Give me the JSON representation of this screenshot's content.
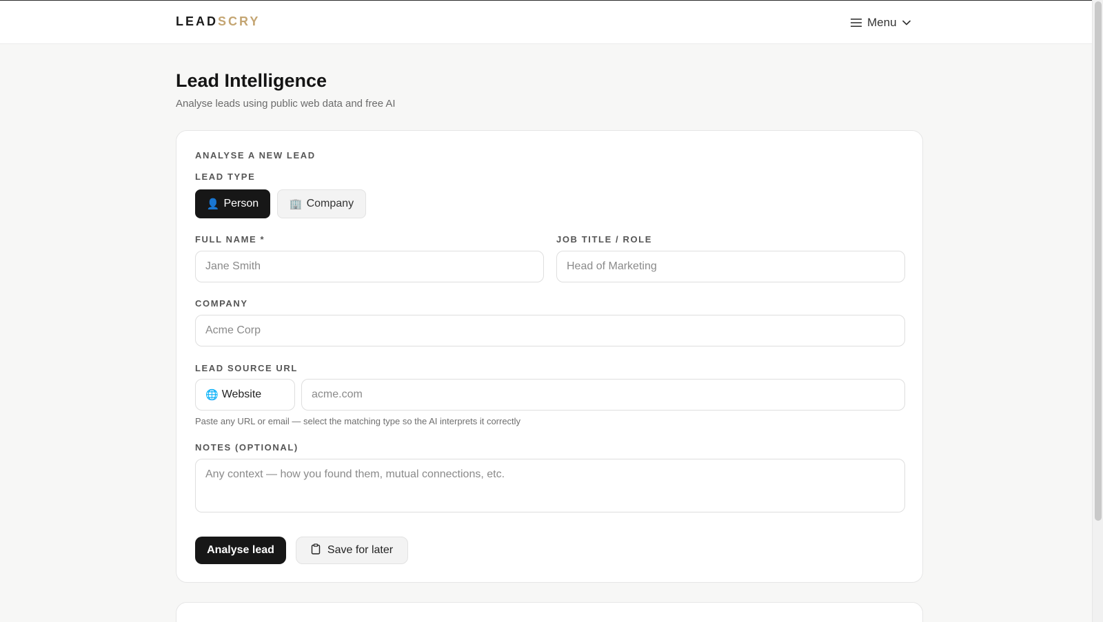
{
  "header": {
    "logo_primary": "LEAD",
    "logo_accent": "SCRY",
    "menu_label": "Menu"
  },
  "page": {
    "title": "Lead Intelligence",
    "subtitle": "Analyse leads using public web data and free AI"
  },
  "form": {
    "section_title": "ANALYSE A NEW LEAD",
    "lead_type_label": "LEAD TYPE",
    "lead_types": [
      {
        "icon": "👤",
        "label": "Person",
        "active": true
      },
      {
        "icon": "🏢",
        "label": "Company",
        "active": false
      }
    ],
    "full_name_label": "FULL NAME *",
    "full_name_placeholder": "Jane Smith",
    "job_title_label": "JOB TITLE / ROLE",
    "job_title_placeholder": "Head of Marketing",
    "company_label": "COMPANY",
    "company_placeholder": "Acme Corp",
    "source_url_label": "LEAD SOURCE URL",
    "source_type": {
      "icon": "🌐",
      "label": "Website"
    },
    "source_url_placeholder": "acme.com",
    "source_hint": "Paste any URL or email — select the matching type so the AI interprets it correctly",
    "notes_label": "NOTES (OPTIONAL)",
    "notes_placeholder": "Any context — how you found them, mutual connections, etc.",
    "analyse_button": "Analyse lead",
    "save_button": "Save for later"
  },
  "colors": {
    "accent": "#c4a572",
    "primary_dark": "#171717",
    "background": "#f7f7f6"
  }
}
